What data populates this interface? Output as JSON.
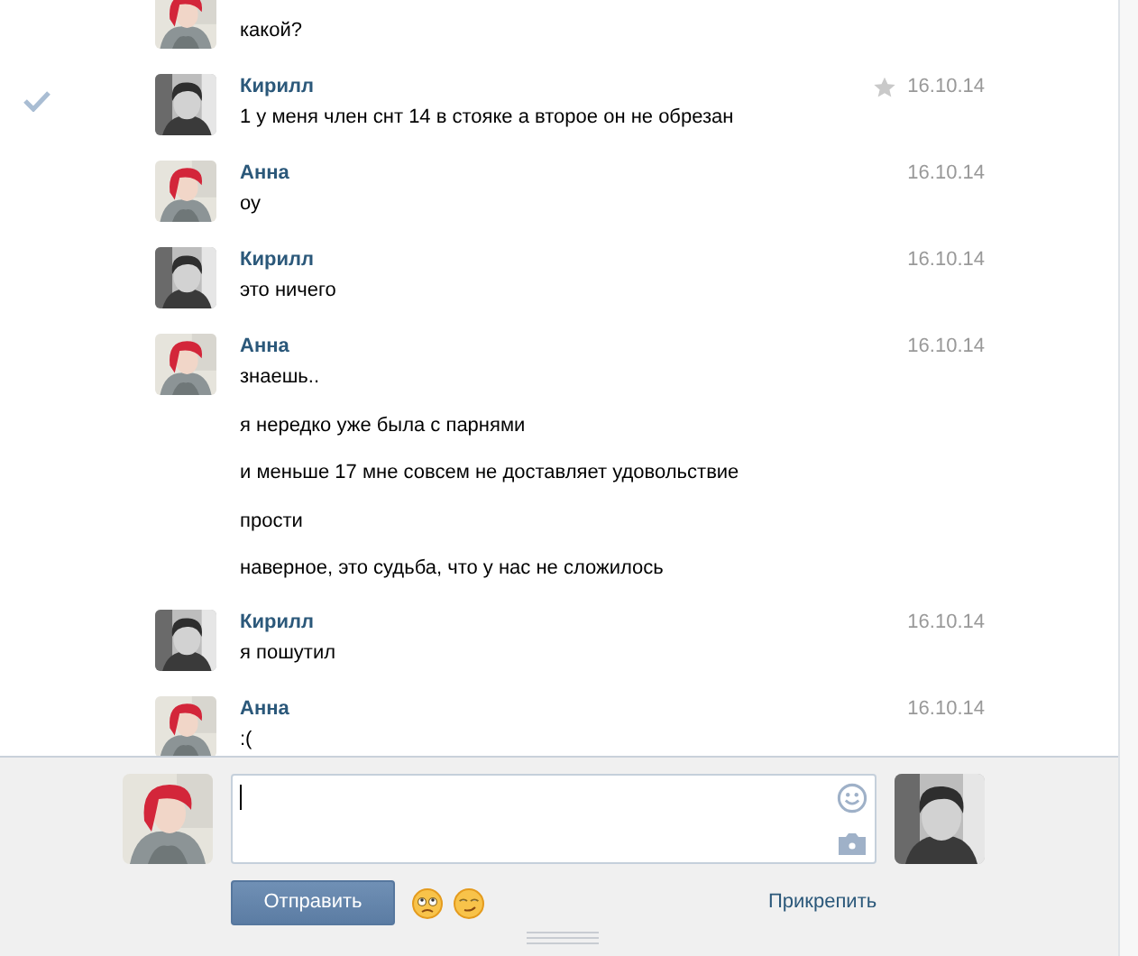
{
  "messages": [
    {
      "selected": false,
      "lines": [
        "какой?"
      ]
    },
    {
      "author": "Кирилл",
      "date": "16.10.14",
      "selected": true,
      "lines": [
        "1 у меня член снт 14 в стояке а второе он не обрезан"
      ]
    },
    {
      "author": "Анна",
      "date": "16.10.14",
      "selected": false,
      "lines": [
        "оу"
      ]
    },
    {
      "author": "Кирилл",
      "date": "16.10.14",
      "selected": false,
      "lines": [
        "это ничего"
      ]
    },
    {
      "author": "Анна",
      "date": "16.10.14",
      "selected": false,
      "lines": [
        "знаешь..",
        "я нередко уже была с парнями",
        "и меньше 17 мне совсем не доставляет удовольствие",
        "прости",
        "наверное, это судьба, что у нас не сложилось"
      ]
    },
    {
      "author": "Кирилл",
      "date": "16.10.14",
      "selected": false,
      "lines": [
        "я пошутил"
      ]
    },
    {
      "author": "Анна",
      "date": "16.10.14",
      "selected": false,
      "lines": [
        ":("
      ]
    }
  ],
  "composer": {
    "send_button": "Отправить",
    "attach_link": "Прикрепить"
  }
}
